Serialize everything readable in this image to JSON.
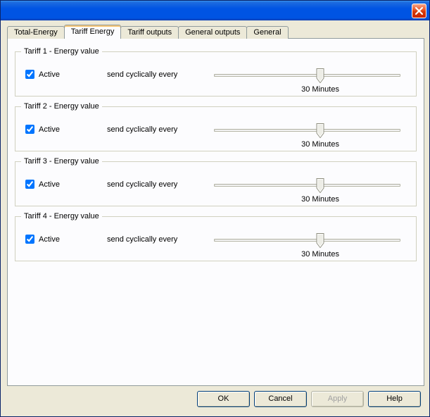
{
  "tabs": {
    "t0": "Total-Energy",
    "t1": "Tariff Energy",
    "t2": "Tariff outputs",
    "t3": "General outputs",
    "t4": "General"
  },
  "groups": [
    {
      "legend": "Tariff 1 - Energy value",
      "active_label": "Active",
      "active_checked": true,
      "send_label": "send cyclically every",
      "slider_pos_pct": 57,
      "value_text": "30 Minutes"
    },
    {
      "legend": "Tariff 2 - Energy value",
      "active_label": "Active",
      "active_checked": true,
      "send_label": "send cyclically every",
      "slider_pos_pct": 57,
      "value_text": "30 Minutes"
    },
    {
      "legend": "Tariff 3 - Energy value",
      "active_label": "Active",
      "active_checked": true,
      "send_label": "send cyclically every",
      "slider_pos_pct": 57,
      "value_text": "30 Minutes"
    },
    {
      "legend": "Tariff 4 - Energy value",
      "active_label": "Active",
      "active_checked": true,
      "send_label": "send cyclically every",
      "slider_pos_pct": 57,
      "value_text": "30 Minutes"
    }
  ],
  "buttons": {
    "ok": "OK",
    "cancel": "Cancel",
    "apply": "Apply",
    "help": "Help"
  }
}
